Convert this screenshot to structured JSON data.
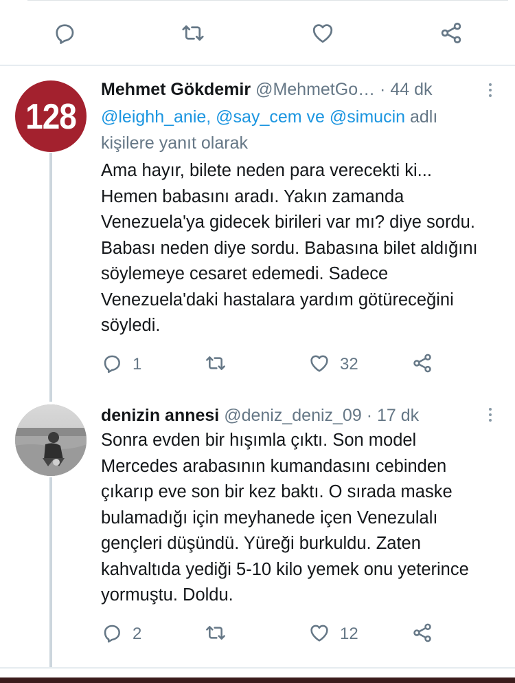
{
  "top_bar": {
    "icons": [
      "reply-icon",
      "retweet-icon",
      "like-icon",
      "share-icon"
    ]
  },
  "tweets": [
    {
      "avatar_text": "128",
      "avatar_color": "#a3212e",
      "name": "Mehmet Gökdemir",
      "handle": "@MehmetGo…",
      "time": " · 44 dk",
      "reply_to": {
        "mention1": "@leighh_anie,",
        "mention2": "@say_cem",
        "conj": "ve",
        "mention3": "@simucin",
        "suffix": "adlı kişilere yanıt olarak"
      },
      "text": "Ama hayır, bilete neden para verecekti ki... Hemen babasını aradı. Yakın zamanda Venezuela'ya gidecek birileri var mı? diye sordu. Babası neden diye sordu. Babasına bilet aldığını söylemeye cesaret edemedi. Sadece Venezuela'daki hastalara yardım götüreceğini söyledi.",
      "reply_count": "1",
      "retweet_count": "",
      "like_count": "32"
    },
    {
      "name": "denizin annesi",
      "handle": "@deniz_deniz_09",
      "time": " · 17 dk",
      "text": "Sonra evden bir hışımla çıktı. Son model Mercedes arabasının kumandasını cebinden çıkarıp eve son bir kez baktı. O sırada maske bulamadığı için meyhanede içen Venezulalı gençleri düşündü. Yüreği burkuldu. Zaten kahvaltıda yediği 5-10 kilo yemek onu yeterince yormuştu. Doldu.",
      "reply_count": "2",
      "retweet_count": "",
      "like_count": "12"
    }
  ],
  "colors": {
    "link": "#1b95e0",
    "secondary_text": "#657786",
    "icon": "#657786",
    "thread_line": "#ccd6dd"
  }
}
